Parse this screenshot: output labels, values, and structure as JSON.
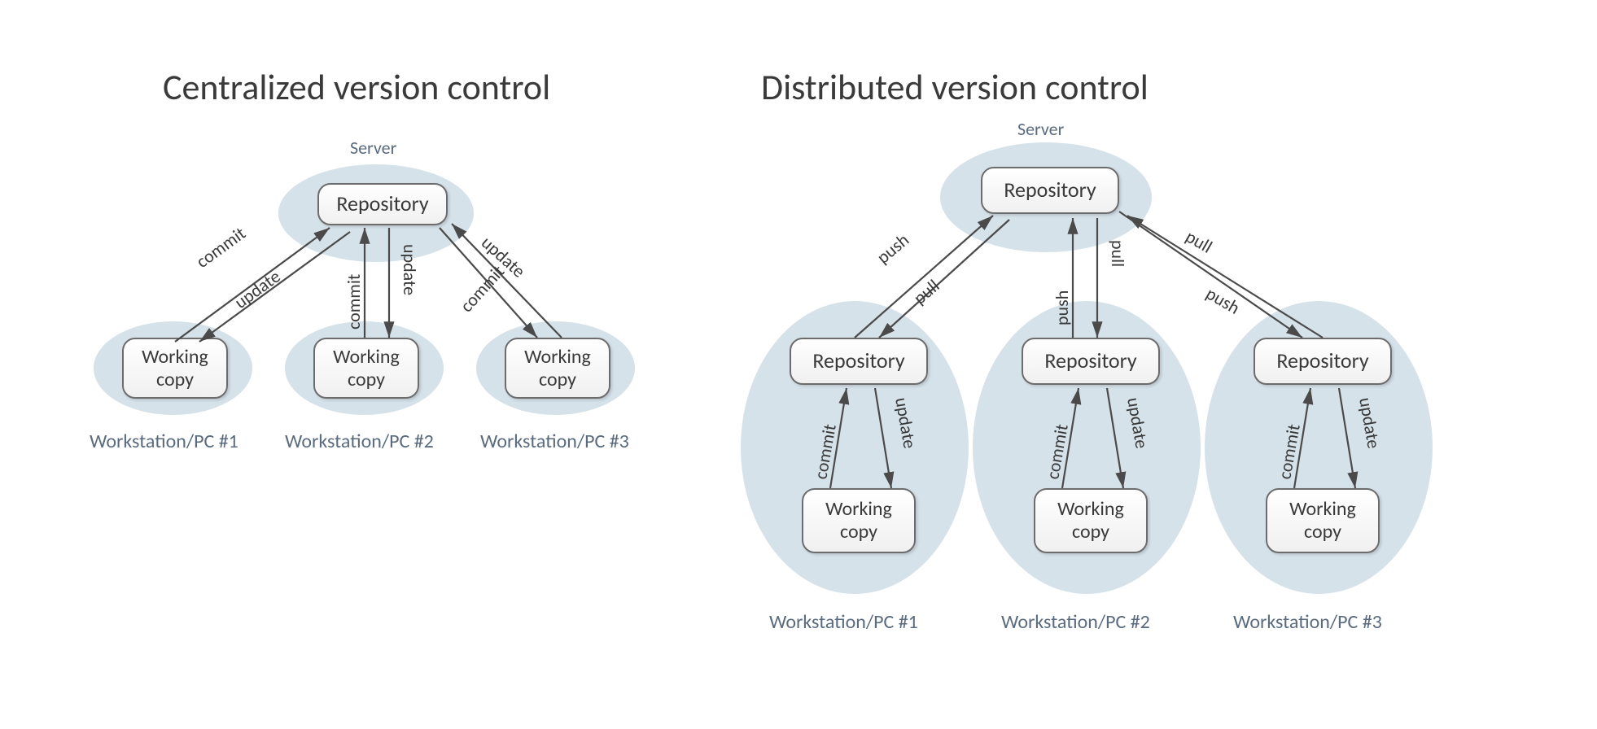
{
  "centralized": {
    "title": "Centralized version control",
    "server_label": "Server",
    "repo_label": "Repository",
    "working_copy_label": "Working\ncopy",
    "edges": {
      "to_server": "commit",
      "from_server": "update"
    },
    "workstations": [
      "Workstation/PC #1",
      "Workstation/PC #2",
      "Workstation/PC #3"
    ]
  },
  "distributed": {
    "title": "Distributed version control",
    "server_label": "Server",
    "repo_label": "Repository",
    "working_copy_label": "Working\ncopy",
    "server_edges": {
      "to_server": "push",
      "from_server": "pull"
    },
    "local_edges": {
      "to_repo": "commit",
      "from_repo": "update"
    },
    "workstations": [
      "Workstation/PC #1",
      "Workstation/PC #2",
      "Workstation/PC #3"
    ]
  }
}
